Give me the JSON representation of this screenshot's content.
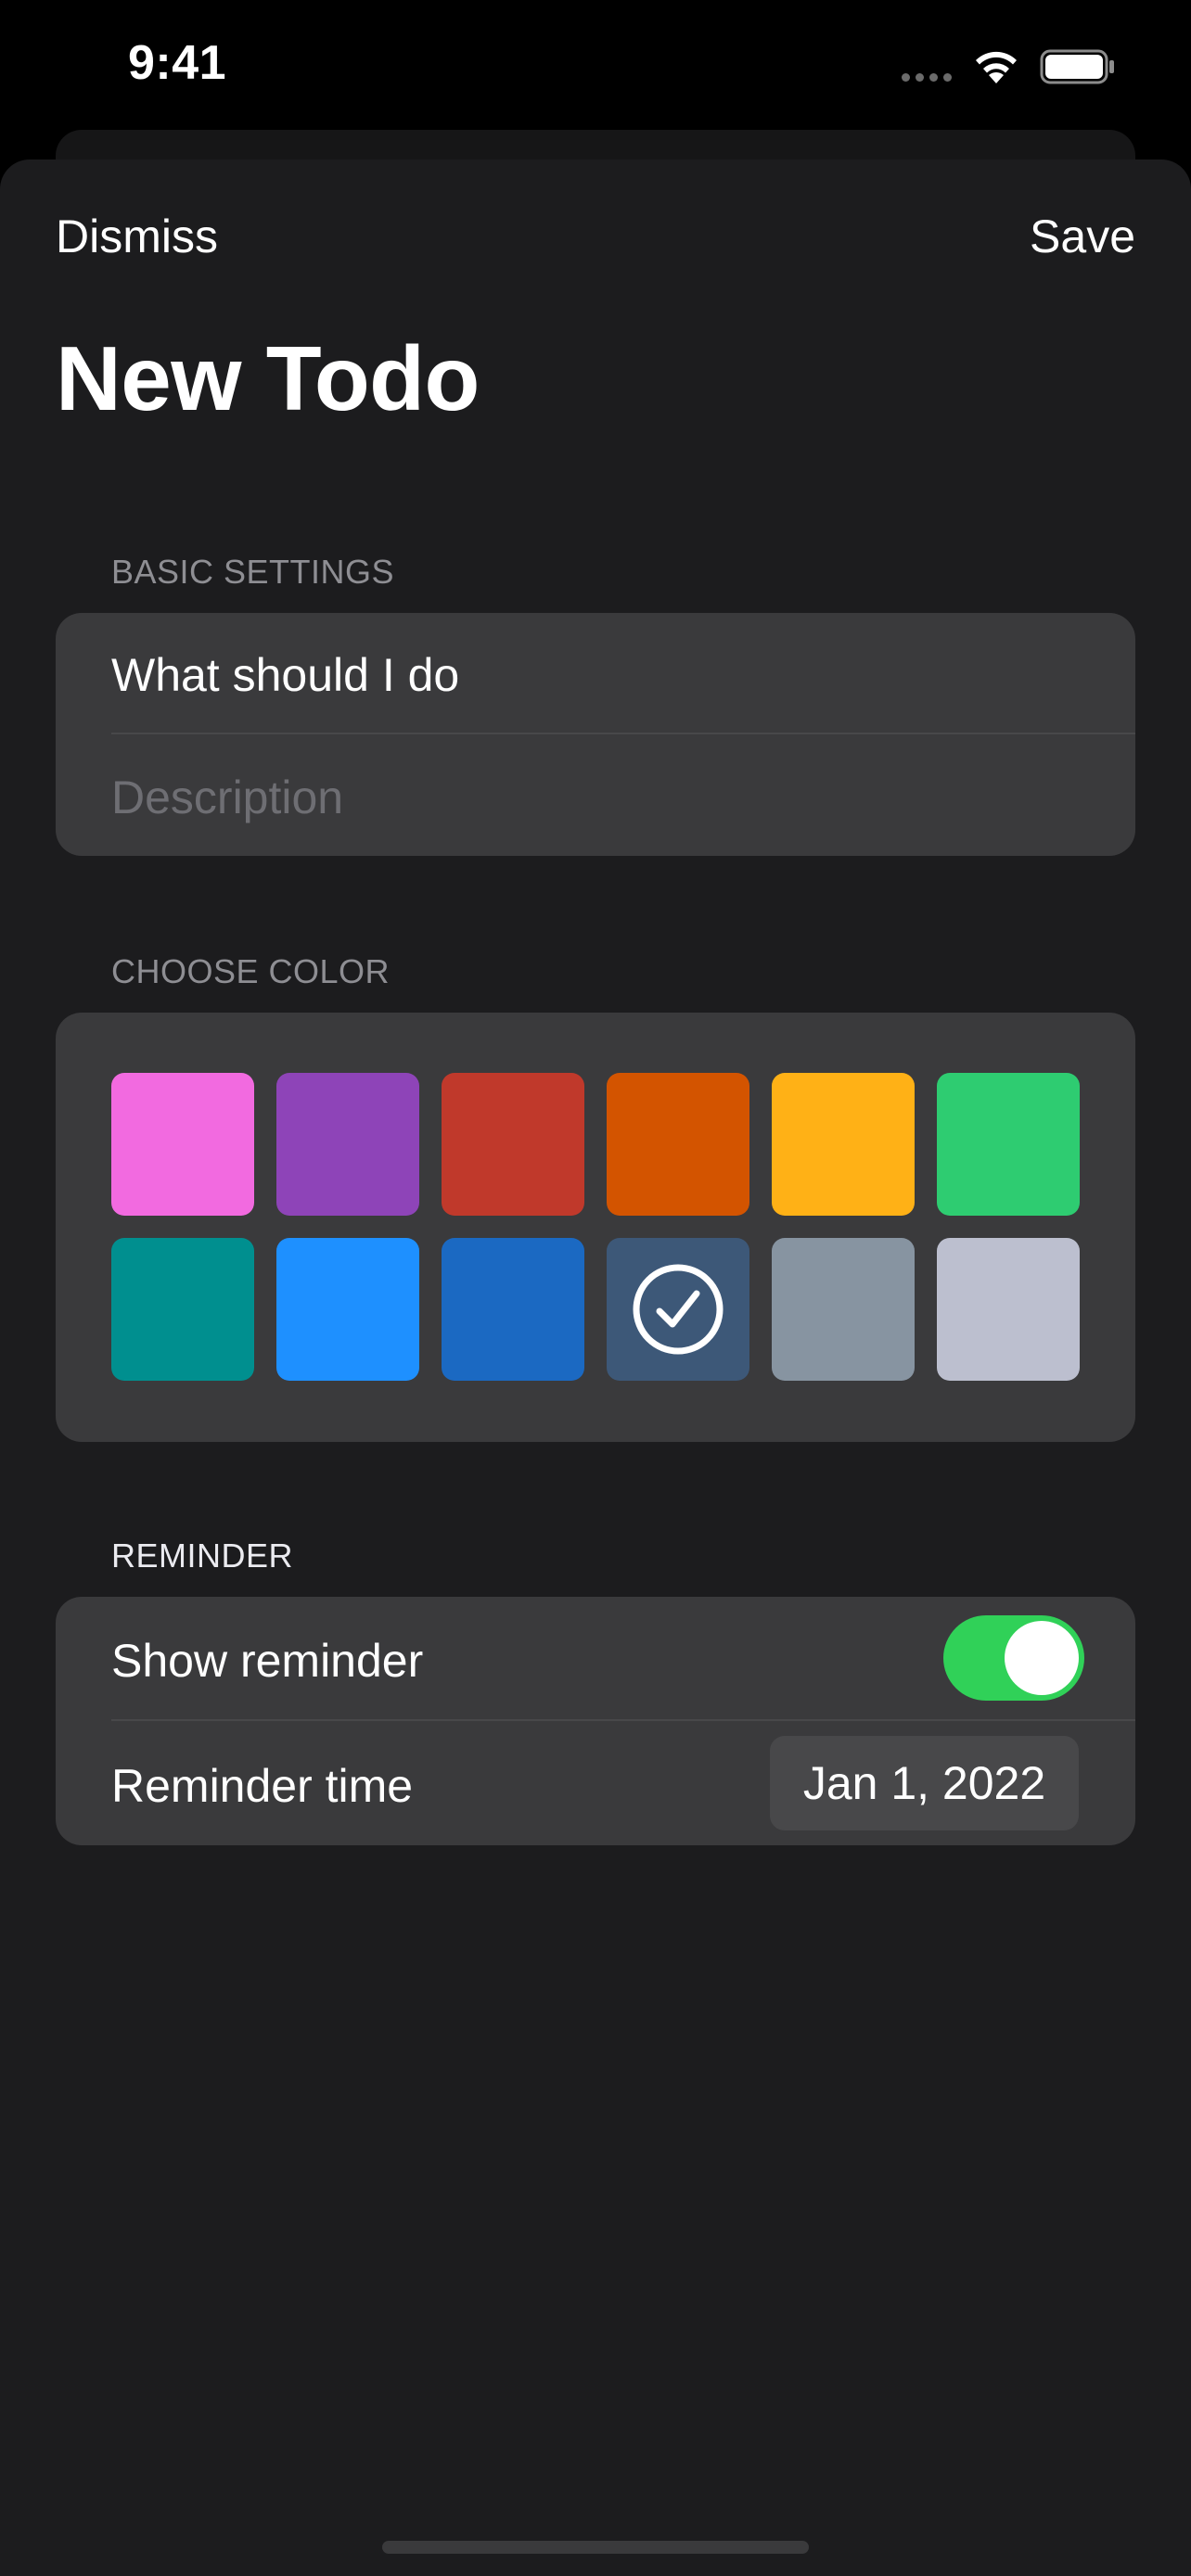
{
  "status_bar": {
    "time": "9:41",
    "signal_icon": "cellular-signal-icon",
    "wifi_icon": "wifi-icon",
    "battery_icon": "battery-full-icon"
  },
  "nav": {
    "dismiss_label": "Dismiss",
    "save_label": "Save",
    "title": "New Todo"
  },
  "basic_settings": {
    "header": "BASIC SETTINGS",
    "title_value": "What should I do",
    "description_placeholder": "Description"
  },
  "color": {
    "header": "CHOOSE COLOR",
    "swatches": [
      "#f26ae0",
      "#8e44b8",
      "#c0392b",
      "#d35400",
      "#ffb116",
      "#2ecc71",
      "#008f8f",
      "#1e90ff",
      "#1b69c2",
      "#3d5878",
      "#8794a1",
      "#bcbfcf"
    ],
    "selected_index": 9,
    "selected_icon": "checkmark-circle-icon"
  },
  "reminder": {
    "header": "REMINDER",
    "show_label": "Show reminder",
    "show_enabled": true,
    "time_label": "Reminder time",
    "time_value": "Jan 1, 2022"
  },
  "colors": {
    "background": "#1c1c1e",
    "group": "#3a3a3c",
    "toggle_on": "#30d158",
    "secondary_text": "#8e8e93"
  }
}
